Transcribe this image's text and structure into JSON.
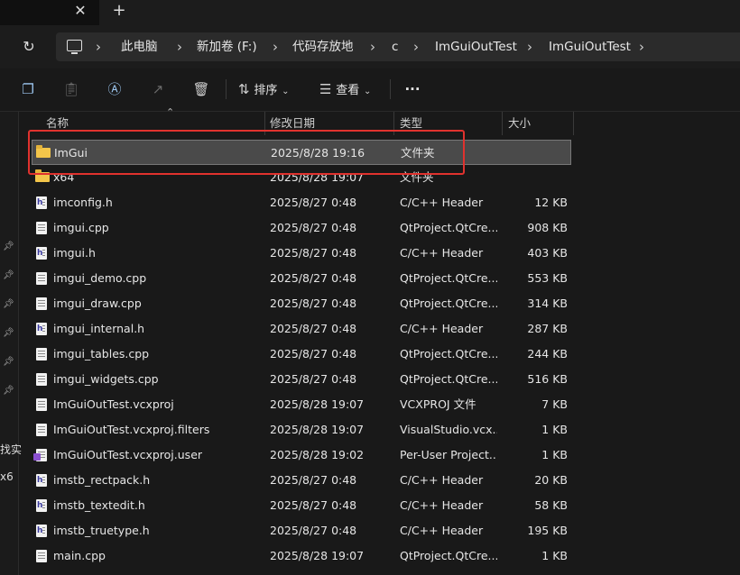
{
  "tabbar": {
    "close_symbol": "✕",
    "add_symbol": "+"
  },
  "address": {
    "refresh_icon": "refresh-icon",
    "computer_icon": "computer-icon",
    "crumbs": [
      "此电脑",
      "新加卷 (F:)",
      "代码存放地",
      "c",
      "ImGuiOutTest",
      "ImGuiOutTest"
    ]
  },
  "toolbar": {
    "sort_label": "排序",
    "view_label": "查看",
    "more_label": "···"
  },
  "nav": {
    "partial_text_1": "找实",
    "partial_text_2": "x6"
  },
  "columns": {
    "name": "名称",
    "date": "修改日期",
    "type": "类型",
    "size": "大小"
  },
  "files": [
    {
      "name": "ImGui",
      "date": "2025/8/28 19:16",
      "type": "文件夹",
      "size": "",
      "icon": "folder",
      "selected": true
    },
    {
      "name": "x64",
      "date": "2025/8/28 19:07",
      "type": "文件夹",
      "size": "",
      "icon": "folder",
      "selected": false
    },
    {
      "name": "imconfig.h",
      "date": "2025/8/27 0:48",
      "type": "C/C++ Header",
      "size": "12 KB",
      "icon": "header",
      "selected": false
    },
    {
      "name": "imgui.cpp",
      "date": "2025/8/27 0:48",
      "type": "QtProject.QtCre...",
      "size": "908 KB",
      "icon": "doc",
      "selected": false
    },
    {
      "name": "imgui.h",
      "date": "2025/8/27 0:48",
      "type": "C/C++ Header",
      "size": "403 KB",
      "icon": "header",
      "selected": false
    },
    {
      "name": "imgui_demo.cpp",
      "date": "2025/8/27 0:48",
      "type": "QtProject.QtCre...",
      "size": "553 KB",
      "icon": "doc",
      "selected": false
    },
    {
      "name": "imgui_draw.cpp",
      "date": "2025/8/27 0:48",
      "type": "QtProject.QtCre...",
      "size": "314 KB",
      "icon": "doc",
      "selected": false
    },
    {
      "name": "imgui_internal.h",
      "date": "2025/8/27 0:48",
      "type": "C/C++ Header",
      "size": "287 KB",
      "icon": "header",
      "selected": false
    },
    {
      "name": "imgui_tables.cpp",
      "date": "2025/8/27 0:48",
      "type": "QtProject.QtCre...",
      "size": "244 KB",
      "icon": "doc",
      "selected": false
    },
    {
      "name": "imgui_widgets.cpp",
      "date": "2025/8/27 0:48",
      "type": "QtProject.QtCre...",
      "size": "516 KB",
      "icon": "doc",
      "selected": false
    },
    {
      "name": "ImGuiOutTest.vcxproj",
      "date": "2025/8/28 19:07",
      "type": "VCXPROJ 文件",
      "size": "7 KB",
      "icon": "doc",
      "selected": false
    },
    {
      "name": "ImGuiOutTest.vcxproj.filters",
      "date": "2025/8/28 19:07",
      "type": "VisualStudio.vcx...",
      "size": "1 KB",
      "icon": "doc",
      "selected": false
    },
    {
      "name": "ImGuiOutTest.vcxproj.user",
      "date": "2025/8/28 19:02",
      "type": "Per-User Project...",
      "size": "1 KB",
      "icon": "vs",
      "selected": false
    },
    {
      "name": "imstb_rectpack.h",
      "date": "2025/8/27 0:48",
      "type": "C/C++ Header",
      "size": "20 KB",
      "icon": "header",
      "selected": false
    },
    {
      "name": "imstb_textedit.h",
      "date": "2025/8/27 0:48",
      "type": "C/C++ Header",
      "size": "58 KB",
      "icon": "header",
      "selected": false
    },
    {
      "name": "imstb_truetype.h",
      "date": "2025/8/27 0:48",
      "type": "C/C++ Header",
      "size": "195 KB",
      "icon": "header",
      "selected": false
    },
    {
      "name": "main.cpp",
      "date": "2025/8/28 19:07",
      "type": "QtProject.QtCre...",
      "size": "1 KB",
      "icon": "doc",
      "selected": false
    }
  ],
  "colors": {
    "selection": "#4a4a4a",
    "annotation": "#e0322e",
    "folder": "#f3c54a"
  }
}
